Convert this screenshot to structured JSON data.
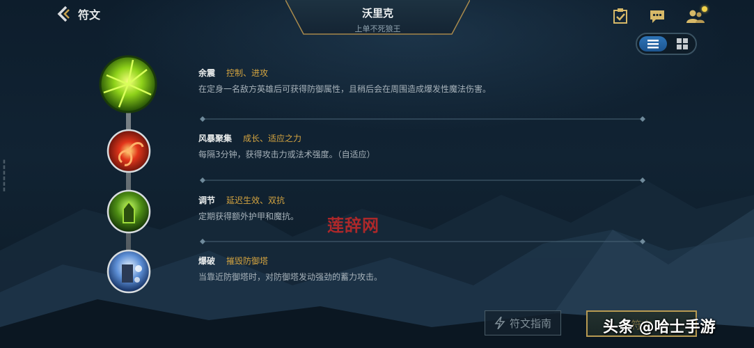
{
  "header": {
    "back_label": "符文",
    "champion_name": "沃里克",
    "champion_title": "上单不死狼王"
  },
  "top_icons": [
    "clipboard-check-icon",
    "chat-icon",
    "friends-icon"
  ],
  "view_toggle": {
    "selected": "list",
    "options": [
      "list",
      "grid"
    ]
  },
  "runes": [
    {
      "name": "余震",
      "tags": "控制、进攻",
      "description": "在定身一名敌方英雄后可获得防御属性，且稍后会在周围造成爆发性魔法伤害。"
    },
    {
      "name": "风暴聚集",
      "tags": "成长、适应之力",
      "description": "每隔3分钟，获得攻击力或法术强度。（自适应）"
    },
    {
      "name": "调节",
      "tags": "延迟生效、双抗",
      "description": "定期获得额外护甲和魔抗。"
    },
    {
      "name": "爆破",
      "tags": "摧毁防御塔",
      "description": "当靠近防御塔时，对防御塔发动强劲的蓄力攻击。"
    }
  ],
  "watermark": "莲辞网",
  "buttons": {
    "guide": "符文指南",
    "gold": "符文"
  },
  "brand_overlay": "头条 @哈士手游",
  "colors": {
    "accent_gold": "#d4a440",
    "toggle_blue": "#2e74b7",
    "notification": "#f2d24a"
  }
}
